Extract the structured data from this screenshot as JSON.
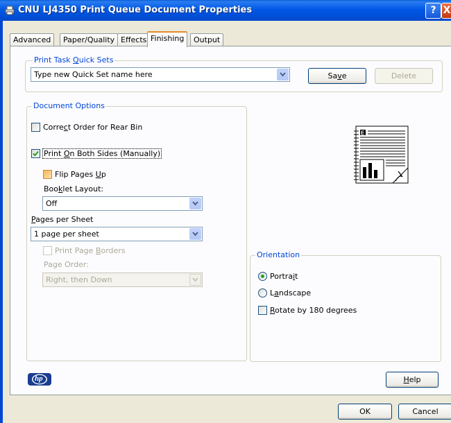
{
  "window": {
    "title": "CNU LJ4350 Print Queue Document Properties",
    "help_glyph": "?",
    "close_glyph": "X"
  },
  "tabs": [
    {
      "label": "Advanced"
    },
    {
      "label": "Paper/Quality"
    },
    {
      "label": "Effects"
    },
    {
      "label": "Finishing",
      "active": true
    },
    {
      "label": "Output"
    }
  ],
  "quick_sets": {
    "legend_pre": "Print Task ",
    "legend_ul": "Q",
    "legend_post": "uick Sets",
    "value": "Type new Quick Set name here",
    "save_pre": "Sa",
    "save_ul": "v",
    "save_post": "e",
    "delete_label": "Delete"
  },
  "document_options": {
    "legend": "Document Options",
    "correct_order": {
      "pre": "Corre",
      "ul": "c",
      "post": "t Order for Rear Bin",
      "checked": false
    },
    "both_sides": {
      "pre": "Print ",
      "ul": "O",
      "post": "n Both Sides (Manually)",
      "checked": true
    },
    "flip_pages": {
      "pre": "Flip Pages ",
      "ul": "U",
      "post": "p",
      "checked": false
    },
    "booklet_label": {
      "pre": "Boo",
      "ul": "k",
      "post": "let Layout:"
    },
    "booklet_value": "Off",
    "pages_per_sheet_label": {
      "pre": "",
      "ul": "P",
      "post": "ages per Sheet"
    },
    "pages_per_sheet_value": "1 page per sheet",
    "print_borders": {
      "pre": "Print Page ",
      "ul": "B",
      "post": "orders",
      "checked": false
    },
    "page_order_label": "Page Order:",
    "page_order_value": "Right, then Down"
  },
  "orientation": {
    "legend": "Orientation",
    "portrait": {
      "pre": "Portra",
      "ul": "i",
      "post": "t",
      "selected": true
    },
    "landscape": {
      "pre": "L",
      "ul": "a",
      "post": "ndscape",
      "selected": false
    },
    "rotate": {
      "pre": "",
      "ul": "R",
      "post": "otate by 180 degrees",
      "checked": false
    }
  },
  "footer": {
    "help_pre": "",
    "help_ul": "H",
    "help_post": "elp",
    "ok_label": "OK",
    "cancel_label": "Cancel",
    "logo_text": "hp"
  },
  "colors": {
    "accent": "#0046d5",
    "title_bar": "#0058e6",
    "check_green": "#21a121",
    "tab_highlight": "#e68b2c"
  }
}
